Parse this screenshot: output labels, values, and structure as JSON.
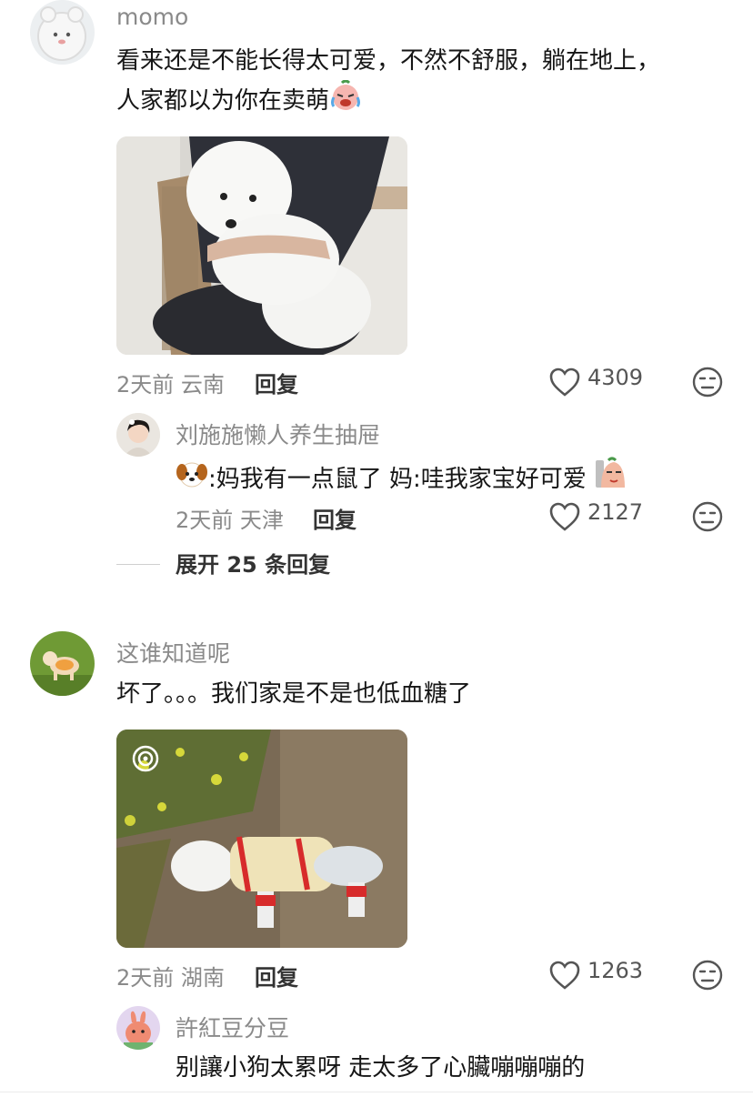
{
  "comments": [
    {
      "user": "momo",
      "text_line1": "看来还是不能长得太可爱，不然不舒服，躺在地上，",
      "text_line2": "人家都以为你在卖萌",
      "text_emoji": "crying-laugh-emoji",
      "time": "2天前",
      "location": "云南",
      "reply_label": "回复",
      "likes": "4309",
      "reply": {
        "user": "刘施施懒人养生抽屉",
        "text": ":妈我有一点鼠了 妈:哇我家宝好可爱",
        "time": "2天前",
        "location": "天津",
        "reply_label": "回复",
        "likes": "2127"
      },
      "expand_label": "展开 25 条回复"
    },
    {
      "user": "这谁知道呢",
      "text": "坏了。。。我们家是不是也低血糖了",
      "time": "2天前",
      "location": "湖南",
      "reply_label": "回复",
      "likes": "1263",
      "reply": {
        "user": "許紅豆分豆",
        "text": "别讓小狗太累呀 走太多了心臟嘣嘣嘣的"
      }
    }
  ],
  "colors": {
    "muted": "#8a8a8a",
    "text": "#161616"
  }
}
